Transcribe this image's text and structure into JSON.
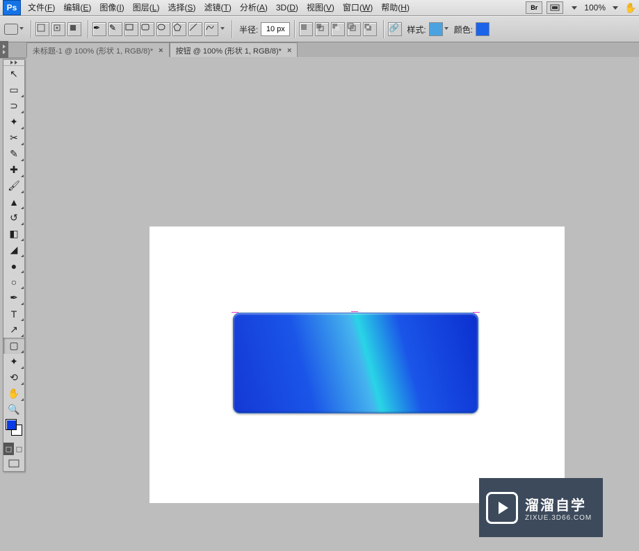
{
  "menu": {
    "items": [
      {
        "label": "文件",
        "hot": "F"
      },
      {
        "label": "编辑",
        "hot": "E"
      },
      {
        "label": "图像",
        "hot": "I"
      },
      {
        "label": "图层",
        "hot": "L"
      },
      {
        "label": "选择",
        "hot": "S"
      },
      {
        "label": "滤镜",
        "hot": "T"
      },
      {
        "label": "分析",
        "hot": "A"
      },
      {
        "label": "3D",
        "hot": "D"
      },
      {
        "label": "视图",
        "hot": "V"
      },
      {
        "label": "窗口",
        "hot": "W"
      },
      {
        "label": "帮助",
        "hot": "H"
      }
    ],
    "logo": "Ps",
    "br_label": "Br",
    "zoom": "100%"
  },
  "options": {
    "radius_label": "半径:",
    "radius_value": "10 px",
    "style_label": "样式:",
    "color_label": "颜色:",
    "style_swatch": "#4aa3e0",
    "color_swatch": "#1b64ea"
  },
  "tabs": [
    {
      "title": "未标题-1 @ 100% (形状 1, RGB/8)*"
    },
    {
      "title": "按钮 @ 100% (形状 1, RGB/8)*"
    }
  ],
  "tools": [
    {
      "name": "move-tool",
      "glyph": "↖",
      "mark": false
    },
    {
      "name": "marquee-tool",
      "glyph": "▭",
      "mark": true
    },
    {
      "name": "lasso-tool",
      "glyph": "⊃",
      "mark": true
    },
    {
      "name": "wand-tool",
      "glyph": "✦",
      "mark": true
    },
    {
      "name": "crop-tool",
      "glyph": "✂",
      "mark": true
    },
    {
      "name": "eyedropper-tool",
      "glyph": "✎",
      "mark": true
    },
    {
      "name": "healing-tool",
      "glyph": "✚",
      "mark": true
    },
    {
      "name": "brush-tool",
      "glyph": "🖌",
      "mark": true
    },
    {
      "name": "stamp-tool",
      "glyph": "▲",
      "mark": true
    },
    {
      "name": "history-brush-tool",
      "glyph": "↺",
      "mark": true
    },
    {
      "name": "eraser-tool",
      "glyph": "◧",
      "mark": true
    },
    {
      "name": "gradient-tool",
      "glyph": "◢",
      "mark": true
    },
    {
      "name": "blur-tool",
      "glyph": "●",
      "mark": true
    },
    {
      "name": "dodge-tool",
      "glyph": "○",
      "mark": true
    },
    {
      "name": "pen-tool",
      "glyph": "✒",
      "mark": true
    },
    {
      "name": "type-tool",
      "glyph": "T",
      "mark": true
    },
    {
      "name": "path-select-tool",
      "glyph": "↗",
      "mark": true
    },
    {
      "name": "shape-tool",
      "glyph": "▢",
      "mark": true,
      "selected": true
    },
    {
      "name": "3d-object-tool",
      "glyph": "✦",
      "mark": true
    },
    {
      "name": "3d-camera-tool",
      "glyph": "⟲",
      "mark": true
    },
    {
      "name": "hand-tool",
      "glyph": "✋",
      "mark": true
    },
    {
      "name": "zoom-tool",
      "glyph": "🔍",
      "mark": false
    }
  ],
  "colors": {
    "foreground": "#0a3be6",
    "background": "#ffffff"
  },
  "watermark": {
    "cn": "溜溜自学",
    "en": "ZIXUE.3D66.COM"
  }
}
